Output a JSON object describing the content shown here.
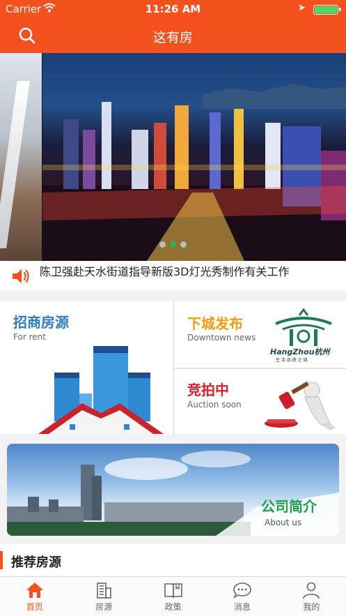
{
  "status": {
    "carrier": "Carrier",
    "time": "11:26 AM"
  },
  "header": {
    "title": "这有房"
  },
  "banner": {
    "dots": 3,
    "active_dot": 1
  },
  "notice": {
    "text": "陈卫强赴天水街道指导新版3D灯光秀制作有关工作"
  },
  "modules": {
    "rent": {
      "title": "招商房源",
      "subtitle": "For rent",
      "color": "#2d7dc9"
    },
    "news": {
      "title": "下城发布",
      "subtitle": "Downtown news",
      "color": "#f59a10",
      "logo_text": "HangZhou杭州",
      "logo_sub": "生 活 品 质 之 城"
    },
    "auction": {
      "title": "竞拍中",
      "subtitle": "Auction soon",
      "color": "#d81f26"
    }
  },
  "about": {
    "title": "公司简介",
    "subtitle": "About us"
  },
  "recommend": {
    "title": "推荐房源"
  },
  "tabs": [
    {
      "label": "首页",
      "icon": "home-icon",
      "active": true
    },
    {
      "label": "房源",
      "icon": "building-icon",
      "active": false
    },
    {
      "label": "政策",
      "icon": "book-icon",
      "active": false
    },
    {
      "label": "消息",
      "icon": "message-icon",
      "active": false
    },
    {
      "label": "我的",
      "icon": "person-icon",
      "active": false
    }
  ],
  "colors": {
    "accent": "#f5511e",
    "active_dot": "#2db34a"
  }
}
